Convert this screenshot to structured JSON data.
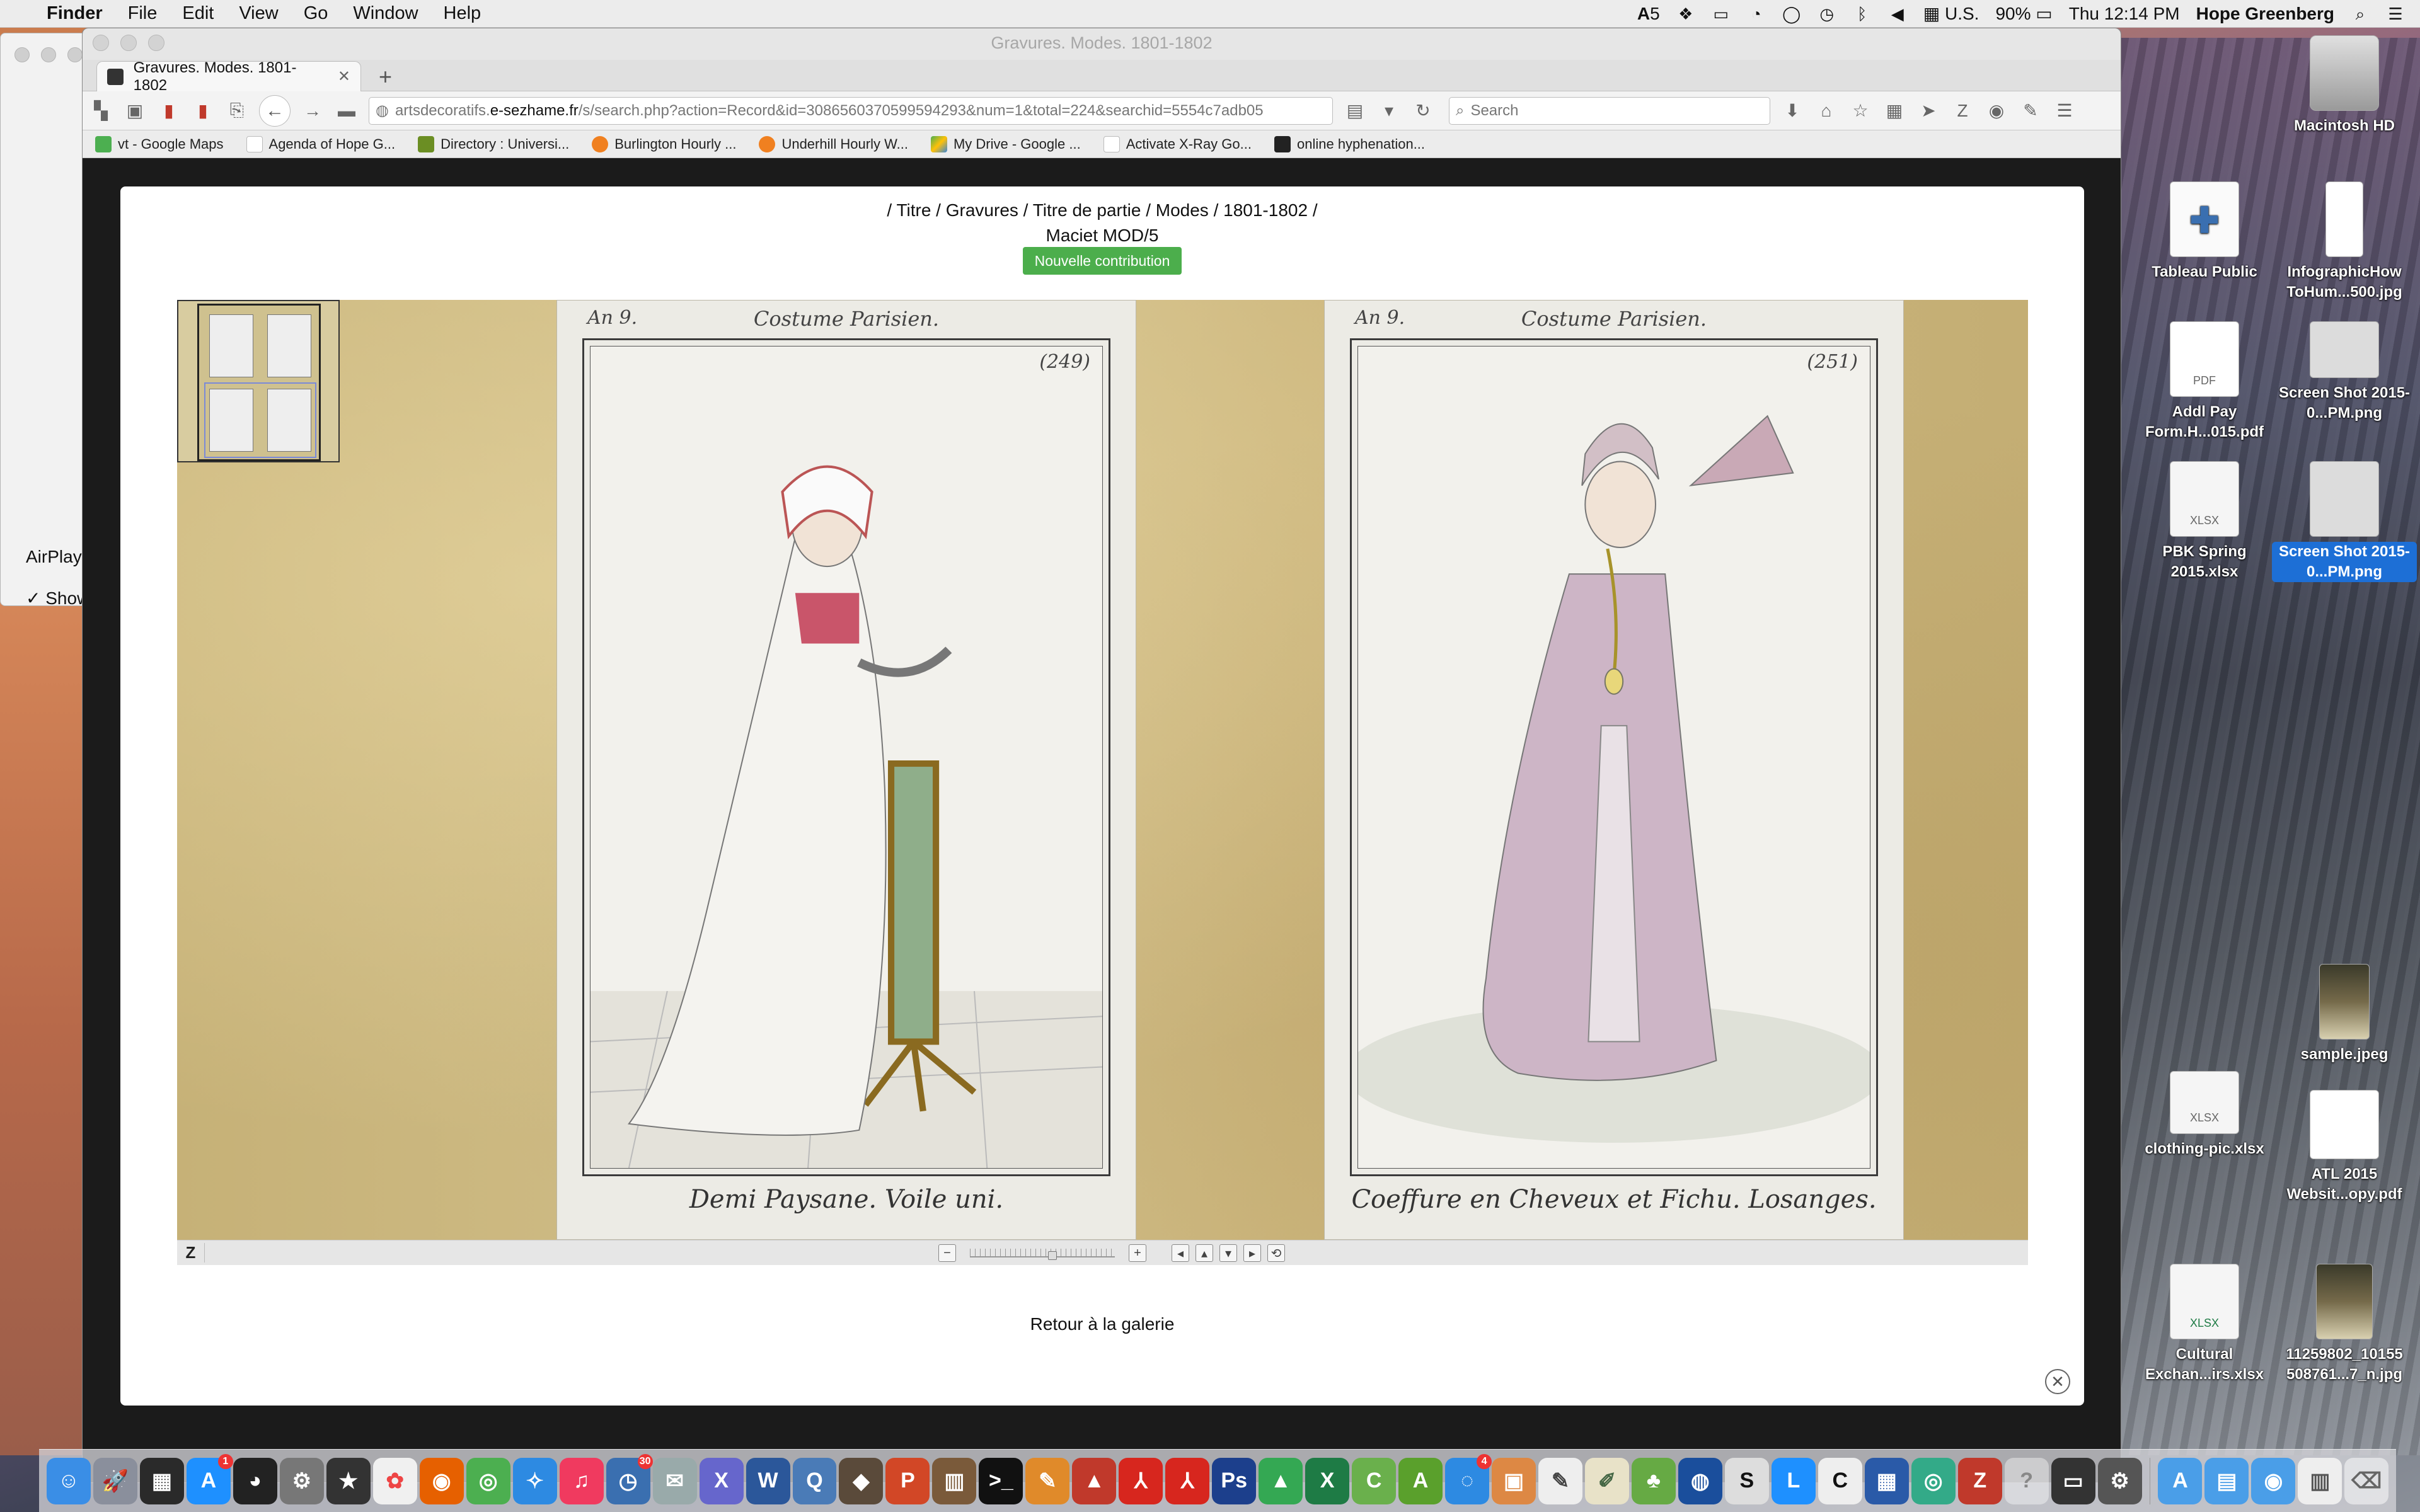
{
  "menubar": {
    "app": "Finder",
    "items": [
      "File",
      "Edit",
      "View",
      "Go",
      "Window",
      "Help"
    ],
    "status": {
      "notif_count": "5",
      "input": "U.S.",
      "battery": "90%",
      "clock": "Thu 12:14 PM",
      "user": "Hope Greenberg"
    }
  },
  "bg_window": {
    "airplay": "AirPlay",
    "show": "Show"
  },
  "browser": {
    "window_title": "Gravures. Modes. 1801-1802",
    "tab_title": "Gravures. Modes. 1801-1802",
    "url_prefix": "artsdecoratifs.",
    "url_domain": "e-sezhame.fr",
    "url_rest": "/s/search.php?action=Record&id=3086560370599594293&num=1&total=224&searchid=5554c7adb05",
    "search_placeholder": "Search",
    "bookmarks": [
      {
        "label": "vt - Google Maps",
        "color": "#4caf50"
      },
      {
        "label": "Agenda of Hope G...",
        "color": "#ffffff"
      },
      {
        "label": "Directory : Universi...",
        "color": "#6b8e23"
      },
      {
        "label": "Burlington Hourly ...",
        "color": "#f08020"
      },
      {
        "label": "Underhill Hourly W...",
        "color": "#f08020"
      },
      {
        "label": "My Drive - Google ...",
        "color": "#3a86d9"
      },
      {
        "label": "Activate X-Ray Go...",
        "color": "#ffffff"
      },
      {
        "label": "online hyphenation...",
        "color": "#222222"
      }
    ]
  },
  "record": {
    "breadcrumb": "/ Titre / Gravures / Titre de partie / Modes / 1801-1802 /",
    "call_number": "Maciet MOD/5",
    "contribution_button": "Nouvelle contribution",
    "plate_left": {
      "an": "An 9.",
      "header": "Costume Parisien.",
      "number": "(249)",
      "caption": "Demi Paysane. Voile uni."
    },
    "plate_right": {
      "an": "An 9.",
      "header": "Costume Parisien.",
      "number": "(251)",
      "caption": "Coeffure en Cheveux et Fichu. Losanges."
    },
    "zoom_logo": "Z",
    "back_link": "Retour à la galerie"
  },
  "desktop": {
    "icons": [
      {
        "label": "Macintosh HD"
      },
      {
        "label": "Tableau Public"
      },
      {
        "label": "InfographicHow ToHum...500.jpg"
      },
      {
        "label": "Addl Pay Form.H...015.pdf",
        "tag": "PDF"
      },
      {
        "label": "Screen Shot 2015-0...PM.png"
      },
      {
        "label": "PBK Spring 2015.xlsx",
        "tag": "XLSX"
      },
      {
        "label": "Screen Shot 2015-0...PM.png"
      },
      {
        "label": "sample.jpeg"
      },
      {
        "label": "clothing-pic.xlsx",
        "tag": "XLSX"
      },
      {
        "label": "ATL 2015 Websit...opy.pdf"
      },
      {
        "label": "Cultural Exchan...irs.xlsx",
        "tag": "XLSX"
      },
      {
        "label": "11259802_10155 508761...7_n.jpg"
      }
    ]
  },
  "dock": {
    "badges": {
      "app_store": "1",
      "calendar": "30",
      "messages": "4"
    },
    "colors": {
      "finder": "#3a8ee6",
      "acrobat": "#d7261e",
      "photoshop": "#1c3f8c",
      "excel": "#1e7b45"
    }
  }
}
